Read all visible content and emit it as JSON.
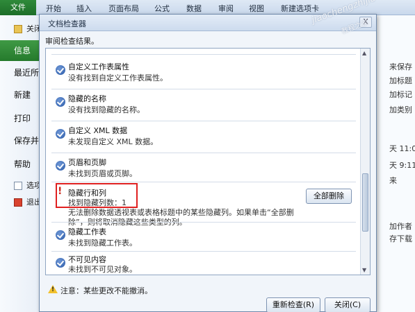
{
  "ribbon": {
    "file_tab": "文件",
    "tabs": [
      "开始",
      "插入",
      "页面布局",
      "公式",
      "数据",
      "审阅",
      "视图",
      "新建选项卡"
    ]
  },
  "nav": {
    "open": "关闭",
    "info": "信息",
    "recent": "最近所",
    "new": "新建",
    "print": "打印",
    "save_send": "保存并",
    "help": "帮助",
    "options": "选项",
    "exit": "退出"
  },
  "right_fragments": [
    "来保存",
    "加标题",
    "加标记",
    "加类别",
    "天 11:0",
    "天 9:11",
    "来",
    "加作者",
    "存下载"
  ],
  "dialog": {
    "title": "文档检查器",
    "close_label": "X",
    "subtitle": "审阅检查结果。",
    "results": [
      {
        "title": "自定义工作表属性",
        "desc": "没有找到自定义工作表属性。",
        "status": "ok"
      },
      {
        "title": "隐藏的名称",
        "desc": "没有找到隐藏的名称。",
        "status": "ok"
      },
      {
        "title": "自定义 XML 数据",
        "desc": "未发现自定义 XML 数据。",
        "status": "ok"
      },
      {
        "title": "页眉和页脚",
        "desc": "未找到页眉或页脚。",
        "status": "ok"
      },
      {
        "title": "隐藏行和列",
        "desc": "找到隐藏列数：1",
        "desc2": "无法删除数据透视表或表格标题中的某些隐藏列。如果单击“全部删",
        "desc3": "除”，则将取消隐藏这些类型的列。",
        "status": "warn"
      },
      {
        "title": "隐藏工作表",
        "desc": "未找到隐藏工作表。",
        "status": "ok"
      },
      {
        "title": "不可见内容",
        "desc": "未找到不可见对象。",
        "status": "ok"
      }
    ],
    "remove_all_label": "全部删除",
    "note": "注意：某些更改不能撤消。",
    "reinspect_label": "重新检查(R)",
    "close_button_label": "关闭(C)"
  },
  "colors": {
    "file_tab": "#1d6e28",
    "warning": "#cc2a1e",
    "highlight_box": "#e02020",
    "check_icon": "#2a5aa8"
  },
  "watermark": {
    "line1": "jiaochengzhijia",
    "line2": "教程之家"
  }
}
